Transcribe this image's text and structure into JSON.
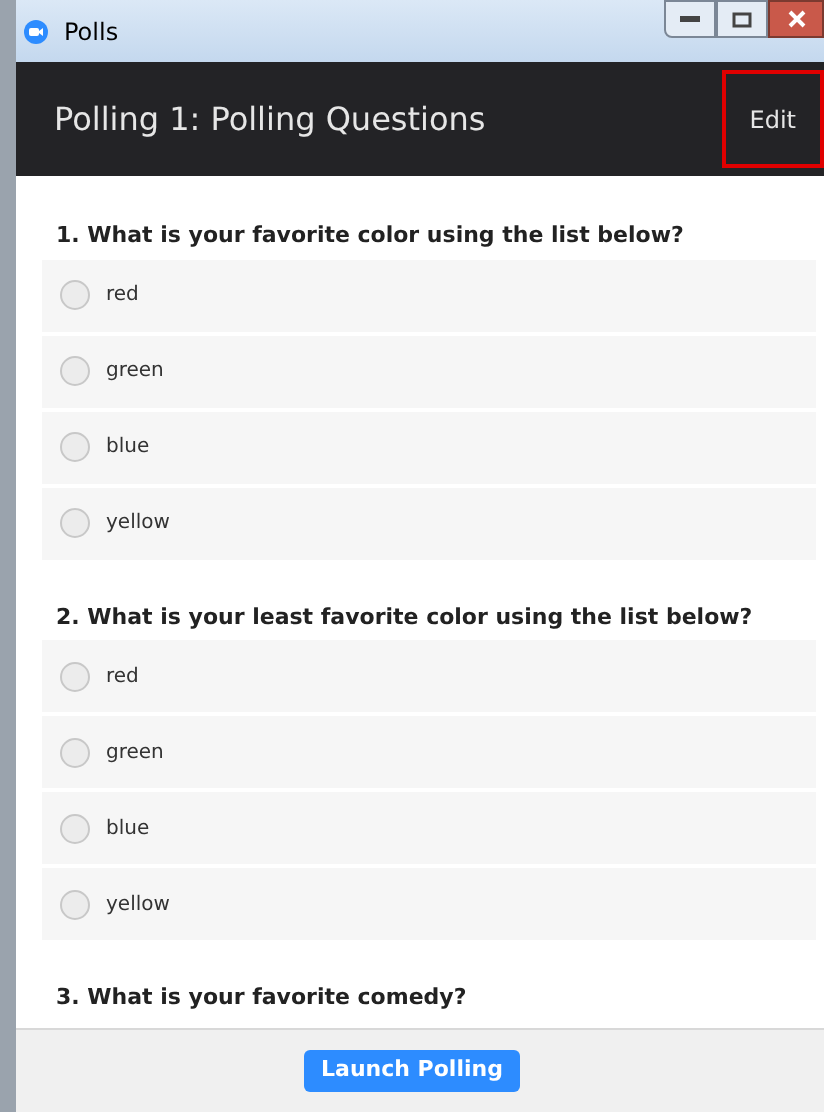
{
  "window": {
    "title": "Polls"
  },
  "header": {
    "title": "Polling 1: Polling Questions",
    "edit_button": {
      "label": "Edit",
      "highlighted": true
    }
  },
  "questions": [
    {
      "text": "1. What is your favorite color using the list below?",
      "options": [
        {
          "label": "red",
          "selected": false
        },
        {
          "label": "green",
          "selected": false
        },
        {
          "label": "blue",
          "selected": false
        },
        {
          "label": "yellow",
          "selected": false
        }
      ]
    },
    {
      "text": "2. What is your least favorite color using the list below?",
      "options": [
        {
          "label": "red",
          "selected": false
        },
        {
          "label": "green",
          "selected": false
        },
        {
          "label": "blue",
          "selected": false
        },
        {
          "label": "yellow",
          "selected": false
        }
      ]
    },
    {
      "text": "3. What is your favorite comedy?"
    }
  ],
  "footer": {
    "button": "Launch Polling"
  }
}
